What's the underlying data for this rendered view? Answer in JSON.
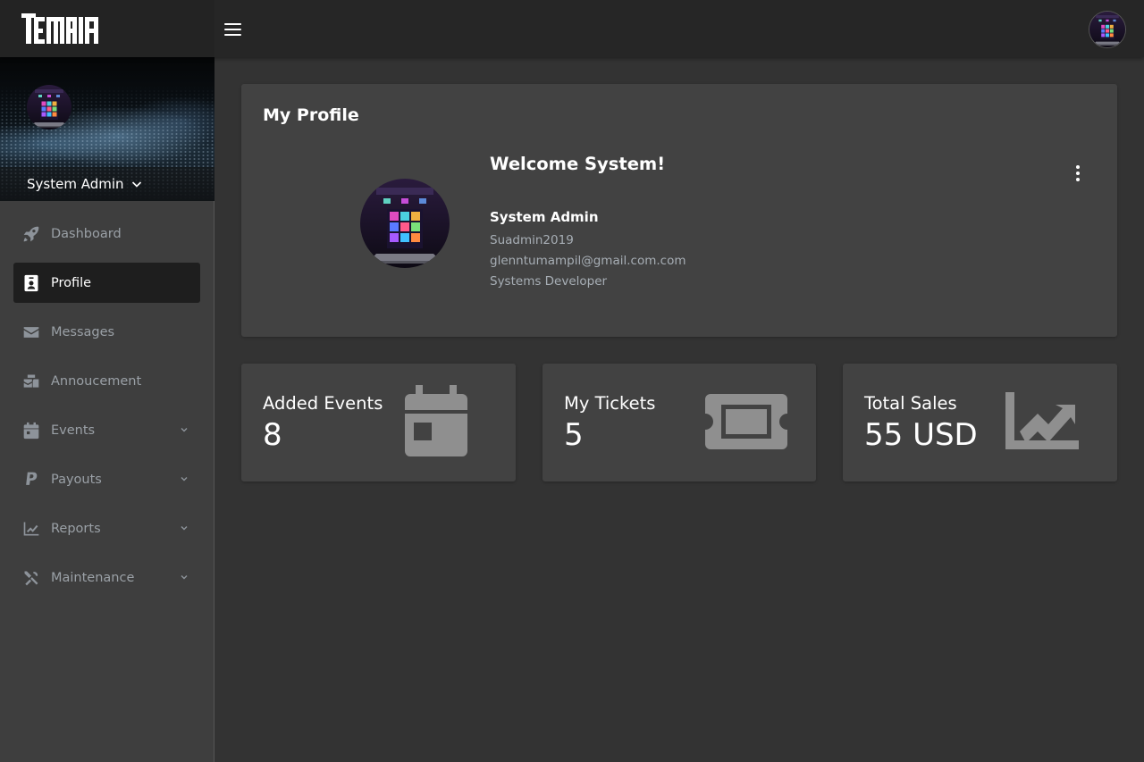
{
  "header": {
    "brand_logo_icon": "temaia-logo",
    "menu_icon": "hamburger-icon",
    "user_avatar_icon": "user-avatar"
  },
  "sidebar": {
    "user": {
      "name": "System Admin",
      "dropdown_icon": "chevron-down-icon"
    },
    "items": [
      {
        "label": "Dashboard",
        "icon": "rocket-icon",
        "active": false,
        "has_submenu": false
      },
      {
        "label": "Profile",
        "icon": "id-badge-icon",
        "active": true,
        "has_submenu": false
      },
      {
        "label": "Messages",
        "icon": "envelope-icon",
        "active": false,
        "has_submenu": false
      },
      {
        "label": "Annoucement",
        "icon": "mail-bulk-icon",
        "active": false,
        "has_submenu": false
      },
      {
        "label": "Events",
        "icon": "calendar-icon",
        "active": false,
        "has_submenu": true
      },
      {
        "label": "Payouts",
        "icon": "paypal-icon",
        "active": false,
        "has_submenu": true
      },
      {
        "label": "Reports",
        "icon": "chart-line-icon",
        "active": false,
        "has_submenu": true
      },
      {
        "label": "Maintenance",
        "icon": "tools-icon",
        "active": false,
        "has_submenu": true
      }
    ]
  },
  "profile": {
    "title": "My Profile",
    "welcome": "Welcome System!",
    "name": "System Admin",
    "username": "Suadmin2019",
    "email": "glenntumampil@gmail.com.com",
    "role": "Systems Developer",
    "menu_icon": "kebab-menu-icon"
  },
  "stats": [
    {
      "label": "Added Events",
      "value": "8",
      "icon": "calendar-icon"
    },
    {
      "label": "My Tickets",
      "value": "5",
      "icon": "ticket-icon"
    },
    {
      "label": "Total Sales",
      "value": "55 USD",
      "icon": "chart-line-icon"
    }
  ],
  "colors": {
    "background": "#333333",
    "topbar": "#262626",
    "sidebar": "#3e3e3e",
    "card": "#424242",
    "active_item": "#1e1e1e",
    "muted_text": "#9aa0a6",
    "stat_icon": "#8f8f8f"
  }
}
